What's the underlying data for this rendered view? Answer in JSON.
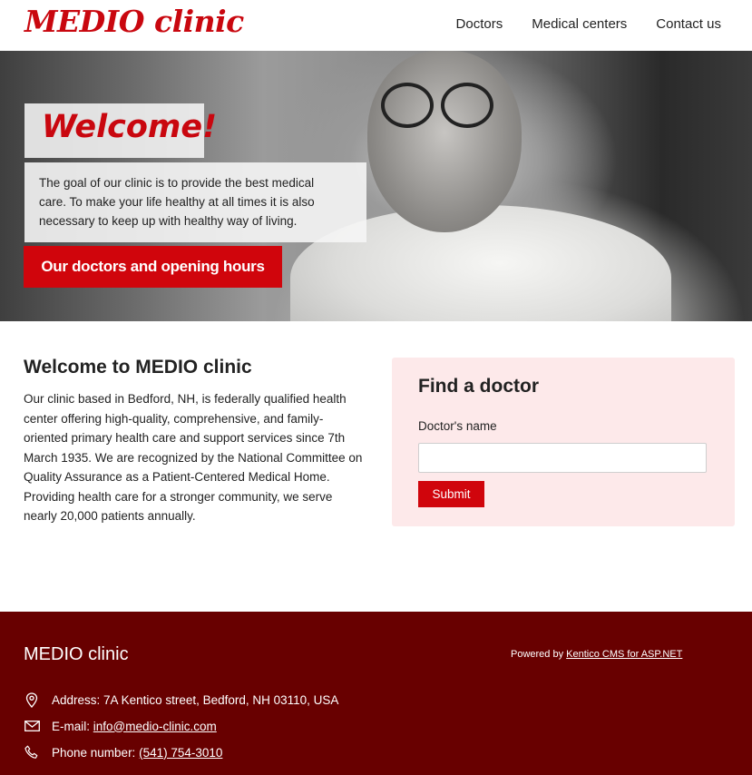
{
  "header": {
    "logo": "MEDIO clinic",
    "nav": [
      "Doctors",
      "Medical centers",
      "Contact us"
    ]
  },
  "hero": {
    "title": "Welcome!",
    "text": "The goal of our clinic is to provide the best medical care. To make your life healthy at all times it is also necessary to keep up with healthy way of living.",
    "button": "Our doctors and opening hours"
  },
  "main": {
    "title": "Welcome to MEDIO clinic",
    "text": "Our clinic based in Bedford, NH, is federally qualified health center offering high-quality, comprehensive, and family-oriented primary health care and support services since 7th March 1935. We are recognized by the National Committee on Quality Assurance as a Patient-Centered Medical Home. Providing health care for a stronger community, we serve nearly 20,000 patients annually."
  },
  "find_doctor": {
    "title": "Find a doctor",
    "label": "Doctor's name",
    "value": "",
    "submit": "Submit"
  },
  "footer": {
    "title": "MEDIO clinic",
    "powered_prefix": "Powered by ",
    "powered_link": "Kentico CMS for ASP.NET",
    "address_label": "Address:",
    "address": "7A Kentico street, Bedford, NH 03110, USA",
    "email_label": "E-mail:",
    "email": "info@medio-clinic.com",
    "phone_label": "Phone number:",
    "phone": "(541) 754-3010"
  },
  "icons": {
    "address": "map-pin-icon",
    "email": "envelope-icon",
    "phone": "phone-icon"
  },
  "colors": {
    "brand_red": "#c9070f",
    "button_red": "#d0050c",
    "footer_bg": "#680000",
    "card_bg": "#fde9ea"
  }
}
